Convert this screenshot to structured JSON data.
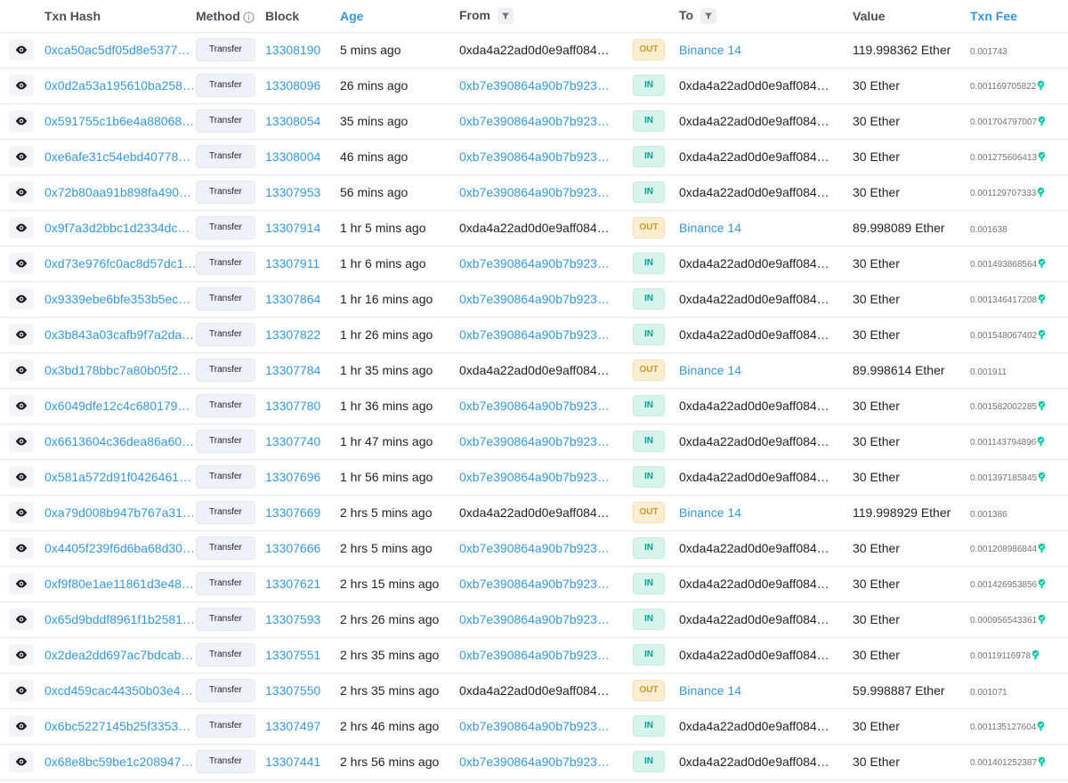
{
  "headers": {
    "txn_hash": "Txn Hash",
    "method": "Method",
    "block": "Block",
    "age": "Age",
    "from": "From",
    "to": "To",
    "value": "Value",
    "txn_fee": "Txn Fee"
  },
  "colors": {
    "link": "#3498db",
    "out_badge_bg": "#fbeed0",
    "out_badge_text": "#c89a25",
    "in_badge_bg": "#d6f4ec",
    "in_badge_text": "#00a186",
    "gas_icon": "#00c9a7"
  },
  "icons": {
    "eye": "eye-icon",
    "info": "info-icon",
    "filter": "filter-icon",
    "gas": "gas-icon"
  },
  "rows": [
    {
      "hash": "0xca50ac5df05d8e5377…",
      "method": "Transfer",
      "block": "13308190",
      "age": "5 mins ago",
      "from": "0xda4a22ad0d0e9aff084…",
      "dir": "OUT",
      "to": "Binance 14",
      "value": "119.998362 Ether",
      "fee": "0.001743"
    },
    {
      "hash": "0x0d2a53a195610ba258…",
      "method": "Transfer",
      "block": "13308096",
      "age": "26 mins ago",
      "from": "0xb7e390864a90b7b923…",
      "dir": "IN",
      "to": "0xda4a22ad0d0e9aff084…",
      "value": "30 Ether",
      "fee": "0.001169705822"
    },
    {
      "hash": "0x591755c1b6e4a88068…",
      "method": "Transfer",
      "block": "13308054",
      "age": "35 mins ago",
      "from": "0xb7e390864a90b7b923…",
      "dir": "IN",
      "to": "0xda4a22ad0d0e9aff084…",
      "value": "30 Ether",
      "fee": "0.001704797007"
    },
    {
      "hash": "0xe6afe31c54ebd40778…",
      "method": "Transfer",
      "block": "13308004",
      "age": "46 mins ago",
      "from": "0xb7e390864a90b7b923…",
      "dir": "IN",
      "to": "0xda4a22ad0d0e9aff084…",
      "value": "30 Ether",
      "fee": "0.001275606413"
    },
    {
      "hash": "0x72b80aa91b898fa490…",
      "method": "Transfer",
      "block": "13307953",
      "age": "56 mins ago",
      "from": "0xb7e390864a90b7b923…",
      "dir": "IN",
      "to": "0xda4a22ad0d0e9aff084…",
      "value": "30 Ether",
      "fee": "0.001129707333"
    },
    {
      "hash": "0x9f7a3d2bbc1d2334dc…",
      "method": "Transfer",
      "block": "13307914",
      "age": "1 hr 5 mins ago",
      "from": "0xda4a22ad0d0e9aff084…",
      "dir": "OUT",
      "to": "Binance 14",
      "value": "89.998089 Ether",
      "fee": "0.001638"
    },
    {
      "hash": "0xd73e976fc0ac8d57dc1…",
      "method": "Transfer",
      "block": "13307911",
      "age": "1 hr 6 mins ago",
      "from": "0xb7e390864a90b7b923…",
      "dir": "IN",
      "to": "0xda4a22ad0d0e9aff084…",
      "value": "30 Ether",
      "fee": "0.001493868564"
    },
    {
      "hash": "0x9339ebe6bfe353b5ec…",
      "method": "Transfer",
      "block": "13307864",
      "age": "1 hr 16 mins ago",
      "from": "0xb7e390864a90b7b923…",
      "dir": "IN",
      "to": "0xda4a22ad0d0e9aff084…",
      "value": "30 Ether",
      "fee": "0.001346417208"
    },
    {
      "hash": "0x3b843a03cafb9f7a2da…",
      "method": "Transfer",
      "block": "13307822",
      "age": "1 hr 26 mins ago",
      "from": "0xb7e390864a90b7b923…",
      "dir": "IN",
      "to": "0xda4a22ad0d0e9aff084…",
      "value": "30 Ether",
      "fee": "0.001548067402"
    },
    {
      "hash": "0x3bd178bbc7a80b05f2…",
      "method": "Transfer",
      "block": "13307784",
      "age": "1 hr 35 mins ago",
      "from": "0xda4a22ad0d0e9aff084…",
      "dir": "OUT",
      "to": "Binance 14",
      "value": "89.998614 Ether",
      "fee": "0.001911"
    },
    {
      "hash": "0x6049dfe12c4c680179…",
      "method": "Transfer",
      "block": "13307780",
      "age": "1 hr 36 mins ago",
      "from": "0xb7e390864a90b7b923…",
      "dir": "IN",
      "to": "0xda4a22ad0d0e9aff084…",
      "value": "30 Ether",
      "fee": "0.001582002285"
    },
    {
      "hash": "0x6613604c36dea86a60…",
      "method": "Transfer",
      "block": "13307740",
      "age": "1 hr 47 mins ago",
      "from": "0xb7e390864a90b7b923…",
      "dir": "IN",
      "to": "0xda4a22ad0d0e9aff084…",
      "value": "30 Ether",
      "fee": "0.001143794896"
    },
    {
      "hash": "0x581a572d91f0426461…",
      "method": "Transfer",
      "block": "13307696",
      "age": "1 hr 56 mins ago",
      "from": "0xb7e390864a90b7b923…",
      "dir": "IN",
      "to": "0xda4a22ad0d0e9aff084…",
      "value": "30 Ether",
      "fee": "0.001397185845"
    },
    {
      "hash": "0xa79d008b947b767a31…",
      "method": "Transfer",
      "block": "13307669",
      "age": "2 hrs 5 mins ago",
      "from": "0xda4a22ad0d0e9aff084…",
      "dir": "OUT",
      "to": "Binance 14",
      "value": "119.998929 Ether",
      "fee": "0.001386"
    },
    {
      "hash": "0x4405f239f6d6ba68d30…",
      "method": "Transfer",
      "block": "13307666",
      "age": "2 hrs 5 mins ago",
      "from": "0xb7e390864a90b7b923…",
      "dir": "IN",
      "to": "0xda4a22ad0d0e9aff084…",
      "value": "30 Ether",
      "fee": "0.001208986844"
    },
    {
      "hash": "0xf9f80e1ae11861d3e48…",
      "method": "Transfer",
      "block": "13307621",
      "age": "2 hrs 15 mins ago",
      "from": "0xb7e390864a90b7b923…",
      "dir": "IN",
      "to": "0xda4a22ad0d0e9aff084…",
      "value": "30 Ether",
      "fee": "0.001426953856"
    },
    {
      "hash": "0x65d9bddf8961f1b2581…",
      "method": "Transfer",
      "block": "13307593",
      "age": "2 hrs 26 mins ago",
      "from": "0xb7e390864a90b7b923…",
      "dir": "IN",
      "to": "0xda4a22ad0d0e9aff084…",
      "value": "30 Ether",
      "fee": "0.000956543361"
    },
    {
      "hash": "0x2dea2dd697ac7bdcab…",
      "method": "Transfer",
      "block": "13307551",
      "age": "2 hrs 35 mins ago",
      "from": "0xb7e390864a90b7b923…",
      "dir": "IN",
      "to": "0xda4a22ad0d0e9aff084…",
      "value": "30 Ether",
      "fee": "0.00119116978"
    },
    {
      "hash": "0xcd459cac44350b03e4…",
      "method": "Transfer",
      "block": "13307550",
      "age": "2 hrs 35 mins ago",
      "from": "0xda4a22ad0d0e9aff084…",
      "dir": "OUT",
      "to": "Binance 14",
      "value": "59.998887 Ether",
      "fee": "0.001071"
    },
    {
      "hash": "0x6bc5227145b25f3353…",
      "method": "Transfer",
      "block": "13307497",
      "age": "2 hrs 46 mins ago",
      "from": "0xb7e390864a90b7b923…",
      "dir": "IN",
      "to": "0xda4a22ad0d0e9aff084…",
      "value": "30 Ether",
      "fee": "0.001135127604"
    },
    {
      "hash": "0x68e8bc59be1c208947…",
      "method": "Transfer",
      "block": "13307441",
      "age": "2 hrs 56 mins ago",
      "from": "0xb7e390864a90b7b923…",
      "dir": "IN",
      "to": "0xda4a22ad0d0e9aff084…",
      "value": "30 Ether",
      "fee": "0.001401252387"
    }
  ]
}
